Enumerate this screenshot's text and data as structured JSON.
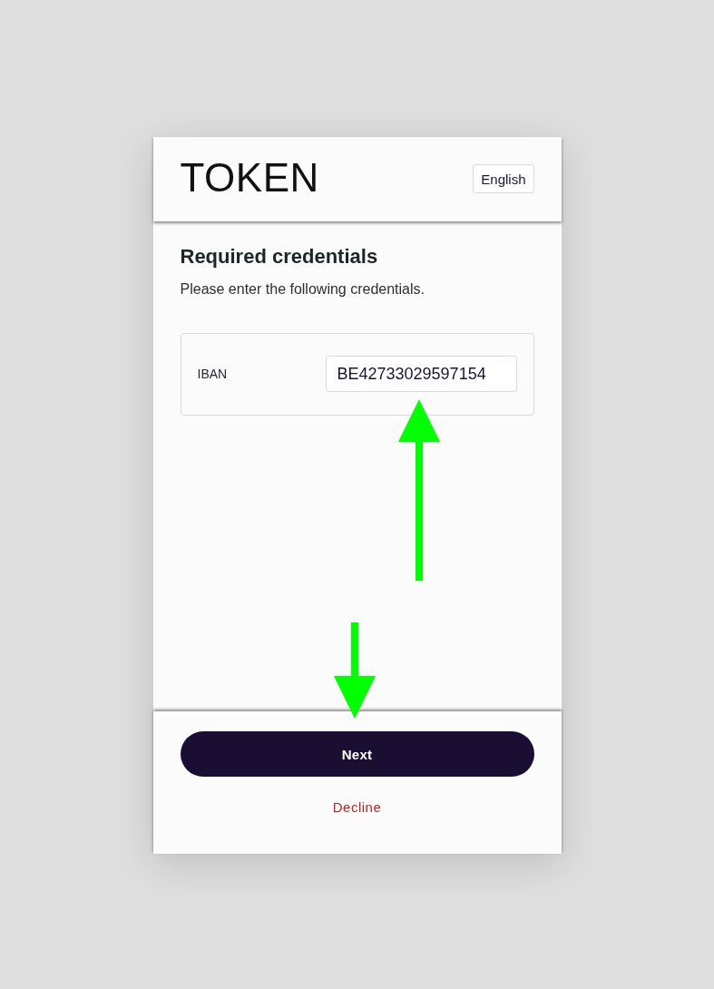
{
  "header": {
    "logo": "TOKEN",
    "language_button": "English"
  },
  "title": "Required credentials",
  "subtitle": "Please enter the following credentials.",
  "fields": [
    {
      "label": "IBAN",
      "value": "BE42733029597154"
    }
  ],
  "buttons": [
    {
      "label": "Next",
      "kind": "primary"
    },
    {
      "label": "Decline",
      "kind": "link"
    }
  ]
}
